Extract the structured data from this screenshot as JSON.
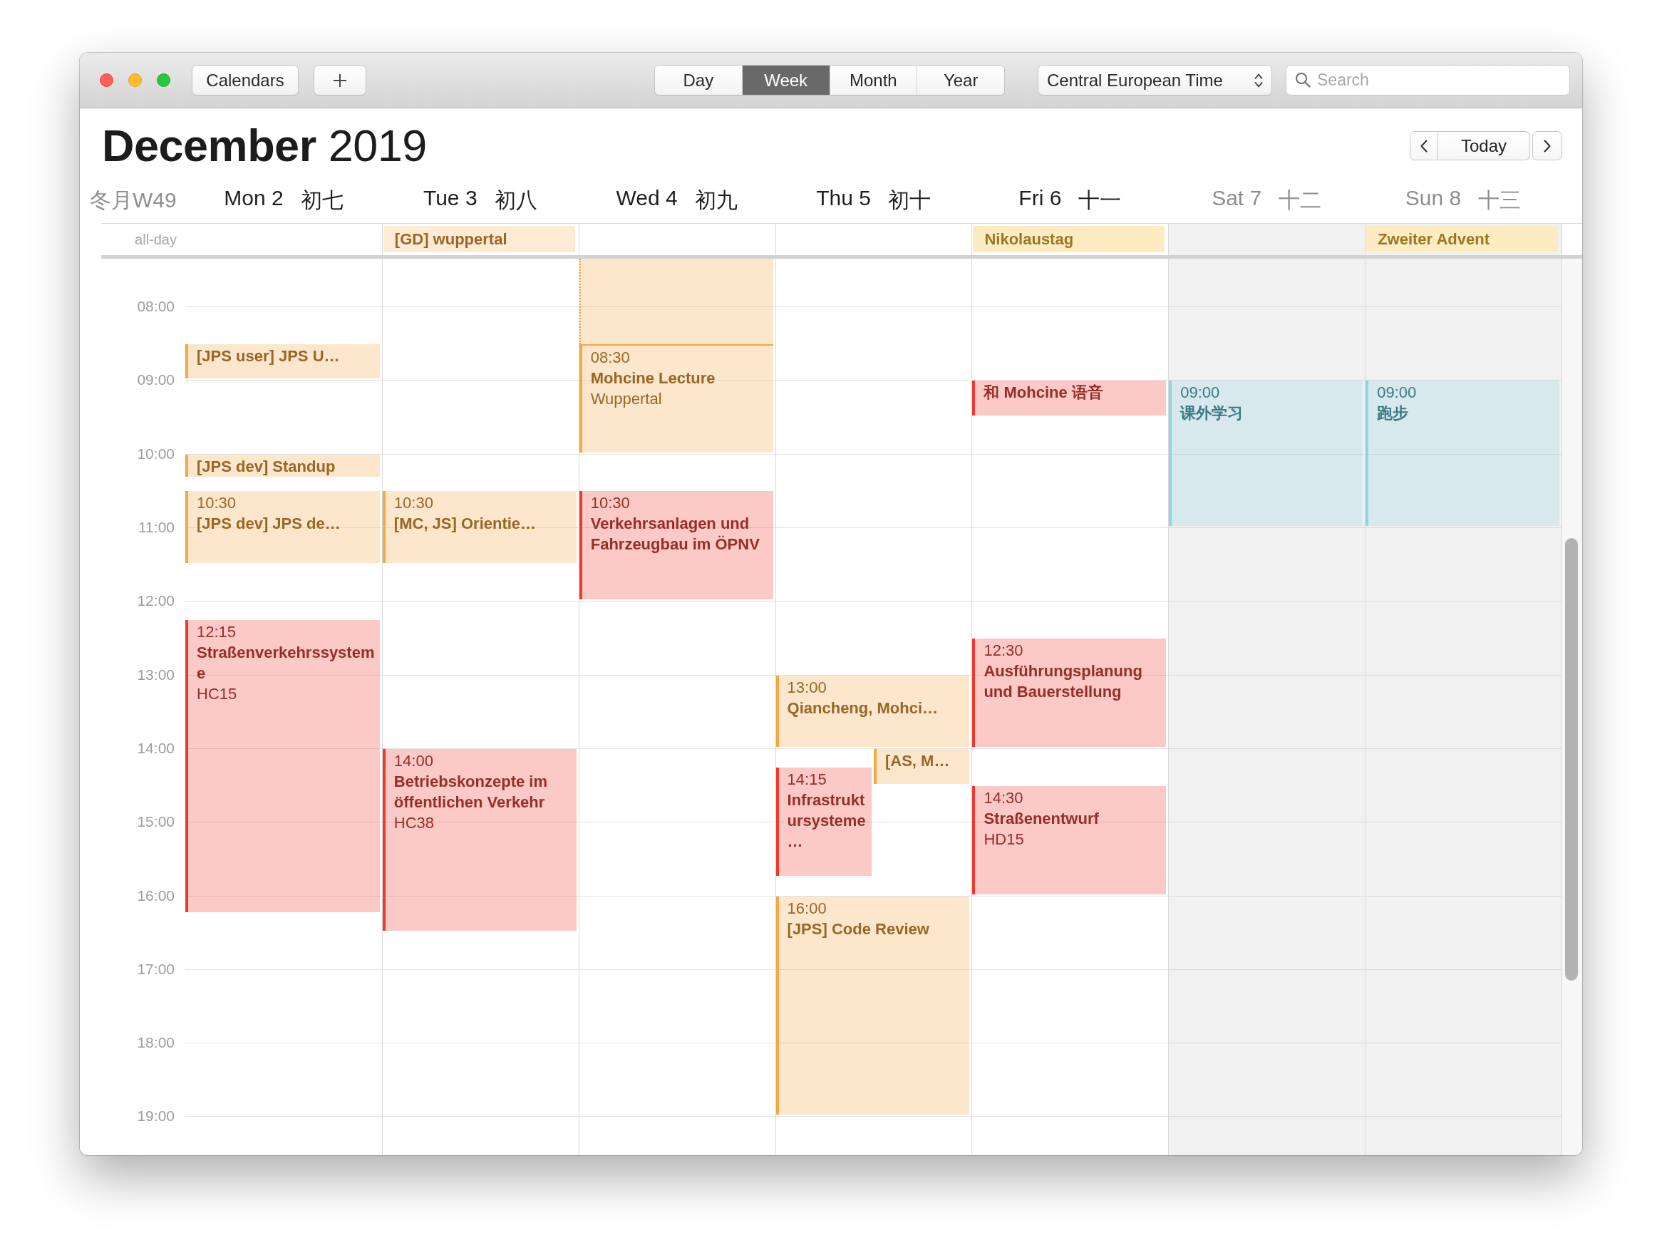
{
  "toolbar": {
    "calendars_button": "Calendars",
    "view_tabs": [
      {
        "label": "Day",
        "selected": false
      },
      {
        "label": "Week",
        "selected": true
      },
      {
        "label": "Month",
        "selected": false
      },
      {
        "label": "Year",
        "selected": false
      }
    ],
    "time_zone": "Central European Time",
    "search": {
      "placeholder": "Search"
    }
  },
  "title": "**December** 2019",
  "today_button": "Today",
  "week_label": "冬月W49",
  "all_day_label": "all-day",
  "hours": [
    "08:00",
    "09:00",
    "10:00",
    "11:00",
    "12:00",
    "13:00",
    "14:00",
    "15:00",
    "16:00",
    "17:00",
    "18:00",
    "19:00"
  ],
  "days": [
    {
      "label": "Mon 2",
      "lunar": "初七",
      "weekend": false,
      "events": [
        {
          "title": "[JPS user] JPS U…",
          "color": "#f5a742"
        },
        {
          "title": "[JPS dev] Standup",
          "color": "#f5a742"
        },
        {
          "time": "10:30",
          "title": "[JPS dev] JPS de…",
          "color": "#f5a742"
        },
        {
          "time": "12:15",
          "title": "Straßenverkehrssysteme",
          "location": "HC15",
          "color": "#f0392c"
        }
      ]
    },
    {
      "label": "Tue 3",
      "lunar": "初八",
      "weekend": false,
      "all_day": [
        {
          "title": "[GD] wuppertal",
          "color": "#fdebd4"
        }
      ],
      "events": [
        {
          "time": "10:30",
          "title": "[MC, JS] Orientie…",
          "color": "#f5a742"
        },
        {
          "time": "14:00",
          "title": "Betriebskonzepte im öffentlichen Verkehr",
          "location": "HC38",
          "color": "#f0392c"
        }
      ]
    },
    {
      "label": "Wed 4",
      "lunar": "初九",
      "weekend": false,
      "events": [
        {
          "time": "08:30",
          "title": "Mohcine Lecture",
          "location": "Wuppertal",
          "travel_time": true,
          "color": "#f5a742"
        },
        {
          "time": "10:30",
          "title": "Verkehrsanlagen und Fahrzeugbau im ÖPNV",
          "color": "#f0392c"
        }
      ]
    },
    {
      "label": "Thu 5",
      "lunar": "初十",
      "weekend": false,
      "events": [
        {
          "time": "13:00",
          "title": "Qiancheng, Mohci…",
          "color": "#f5a742"
        },
        {
          "title": "[AS, M…",
          "color": "#f5a742"
        },
        {
          "time": "14:15",
          "title": "Infrastruktursysteme…",
          "color": "#f0392c"
        },
        {
          "time": "16:00",
          "title": "[JPS] Code Review",
          "color": "#f5a742"
        }
      ]
    },
    {
      "label": "Fri 6",
      "lunar": "十一",
      "weekend": false,
      "all_day": [
        {
          "title": "Nikolaustag",
          "color": "#fdecc2"
        }
      ],
      "events": [
        {
          "title": "和 Mohcine 语音",
          "color": "#f0392c"
        },
        {
          "time": "12:30",
          "title": "Ausführungsplanung und Bauerstellung",
          "color": "#f0392c"
        },
        {
          "time": "14:30",
          "title": "Straßenentwurf",
          "location": "HD15",
          "color": "#f0392c"
        }
      ]
    },
    {
      "label": "Sat 7",
      "lunar": "十二",
      "weekend": true,
      "events": [
        {
          "time": "09:00",
          "title": "课外学习",
          "color": "#8fd4e0"
        }
      ]
    },
    {
      "label": "Sun 8",
      "lunar": "十三",
      "weekend": true,
      "all_day": [
        {
          "title": "Zweiter Advent",
          "color": "#fdecc2"
        }
      ],
      "events": [
        {
          "time": "09:00",
          "title": "跑步",
          "color": "#8fd4e0"
        }
      ]
    }
  ]
}
